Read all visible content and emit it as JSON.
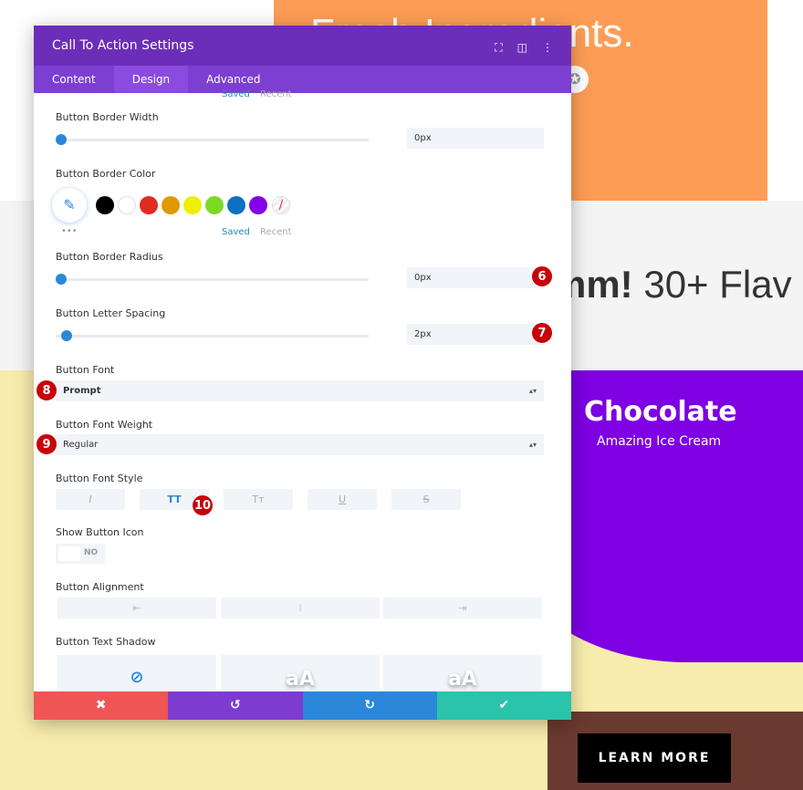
{
  "background": {
    "top_text": "Fresh Ingredients.",
    "headline_bold": "Mmm!",
    "headline_light": "30+ Flav",
    "card_title": "Chocolate",
    "card_subtitle": "Amazing Ice Cream",
    "cta_label": "LEARN MORE"
  },
  "modal": {
    "title": "Call To Action Settings",
    "icons": [
      "fullscreen-icon",
      "split-view-icon",
      "more-options-icon"
    ],
    "tabs": [
      {
        "label": "Content"
      },
      {
        "label": "Design",
        "active": true
      },
      {
        "label": "Advanced"
      }
    ],
    "saved": "Saved",
    "recent": "Recent",
    "border_width": {
      "label": "Button Border Width",
      "value": "0px"
    },
    "border_color": {
      "label": "Button Border Color",
      "swatches": [
        "#000000",
        "#ffffff",
        "#e02b20",
        "#e09900",
        "#edf000",
        "#7cda24",
        "#0c71c3",
        "#8300e9"
      ]
    },
    "border_radius": {
      "label": "Button Border Radius",
      "value": "0px"
    },
    "letter_spacing": {
      "label": "Button Letter Spacing",
      "value": "2px"
    },
    "font": {
      "label": "Button Font",
      "value": "Prompt"
    },
    "font_weight": {
      "label": "Button Font Weight",
      "value": "Regular"
    },
    "font_style": {
      "label": "Button Font Style",
      "options": [
        "I",
        "TT",
        "Tт",
        "U",
        "S"
      ]
    },
    "show_icon": {
      "label": "Show Button Icon",
      "value": "NO"
    },
    "alignment": {
      "label": "Button Alignment"
    },
    "text_shadow": {
      "label": "Button Text Shadow",
      "preview": "aA"
    },
    "badges": [
      "6",
      "7",
      "8",
      "9",
      "10"
    ],
    "footer": {
      "cancel": "✖",
      "undo": "↺",
      "redo": "↻",
      "save": "✔"
    },
    "colors": {
      "header": "#6c2eb9",
      "tabs": "#7d3fd1",
      "accent": "#2b87da",
      "cancel": "#ef5555",
      "undo": "#7e3bd0",
      "redo": "#2b87da",
      "save": "#29c4a9"
    }
  }
}
